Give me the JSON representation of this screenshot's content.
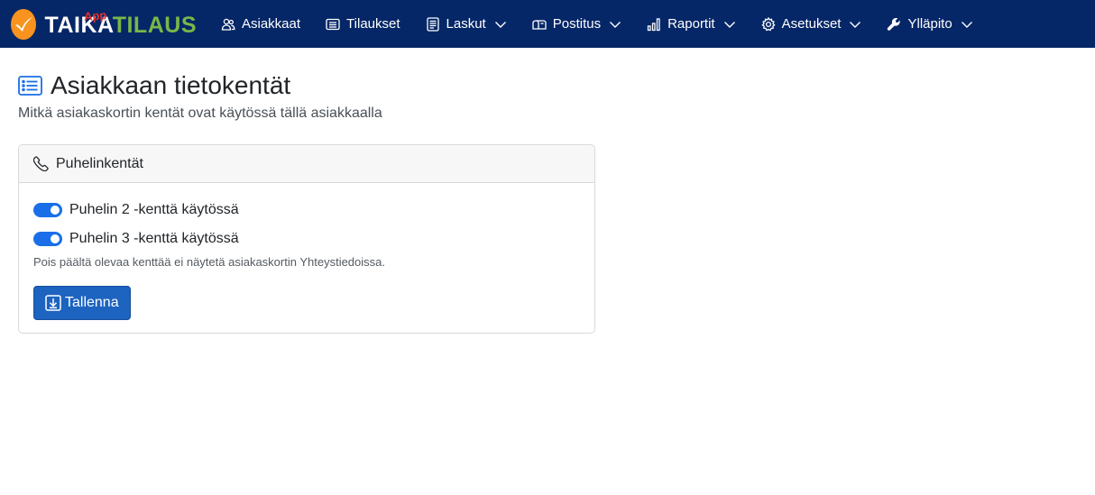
{
  "brand": {
    "name_part1": "TAIKA",
    "name_part2": "TILAUS",
    "badge": "App",
    "colors": {
      "navbar": "#052767",
      "logo": "#f7931e",
      "tilaus": "#7ab648",
      "app": "#e5322d"
    }
  },
  "nav": {
    "items": [
      {
        "label": "Asiakkaat",
        "icon": "users-icon",
        "dropdown": false
      },
      {
        "label": "Tilaukset",
        "icon": "list-icon",
        "dropdown": false
      },
      {
        "label": "Laskut",
        "icon": "document-icon",
        "dropdown": true
      },
      {
        "label": "Postitus",
        "icon": "mailbox-icon",
        "dropdown": true
      },
      {
        "label": "Raportit",
        "icon": "bar-chart-icon",
        "dropdown": true
      },
      {
        "label": "Asetukset",
        "icon": "gear-icon",
        "dropdown": true
      },
      {
        "label": "Ylläpito",
        "icon": "wrench-icon",
        "dropdown": true
      }
    ]
  },
  "page": {
    "title": "Asiakkaan tietokentät",
    "title_icon": "list-icon",
    "subtitle": "Mitkä asiakaskortin kentät ovat käytössä tällä asiakkaalla"
  },
  "card": {
    "title": "Puhelinkentät",
    "title_icon": "phone-icon",
    "switches": [
      {
        "label": "Puhelin 2 -kenttä käytössä",
        "checked": true
      },
      {
        "label": "Puhelin 3 -kenttä käytössä",
        "checked": true
      }
    ],
    "help_text": "Pois päältä olevaa kenttää ei näytetä asiakaskortin Yhteystiedoissa.",
    "save_label": "Tallenna",
    "save_icon": "download-icon",
    "accent": "#1a6fe8"
  }
}
